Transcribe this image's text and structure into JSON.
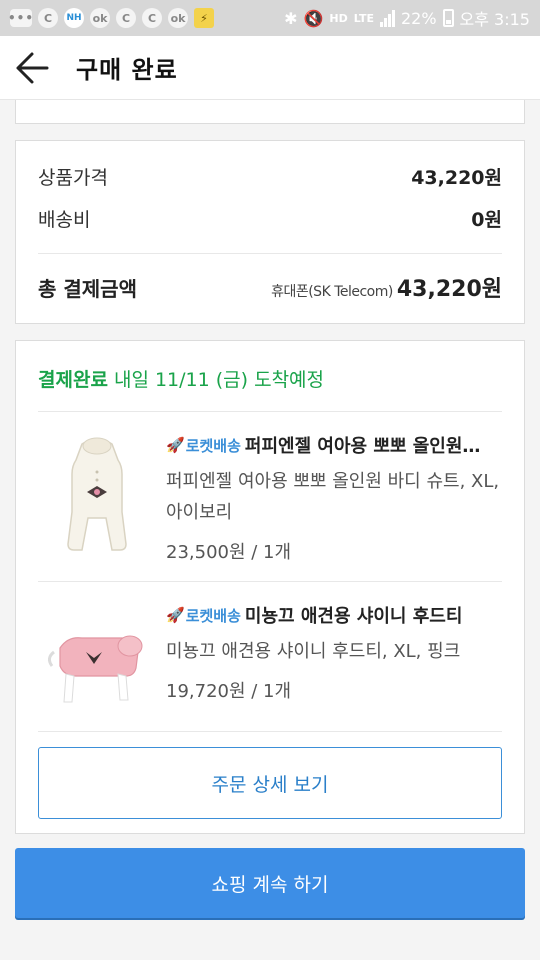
{
  "status_bar": {
    "icons": [
      "notification-dots-icon",
      "c-app-icon",
      "nh-app-icon",
      "ok-app-icon",
      "c-app-icon",
      "c-app-icon",
      "ok-app-icon",
      "pikachu-app-icon"
    ],
    "nh_text": "NH",
    "ok_text": "ok",
    "c_text": "C",
    "right_icons": [
      "bluetooth-icon",
      "mute-icon",
      "hd-voice-icon",
      "lte-icon",
      "signal-icon",
      "battery-icon"
    ],
    "hd_text": "HD",
    "lte_text": "LTE",
    "battery": "22%",
    "time": "오후 3:15"
  },
  "header": {
    "title": "구매 완료"
  },
  "price_summary": {
    "product_price_label": "상품가격",
    "product_price_value": "43,220원",
    "shipping_label": "배송비",
    "shipping_value": "0원",
    "total_label": "총 결제금액",
    "payment_method": "휴대폰(SK Telecom)",
    "total_value": "43,220원"
  },
  "order": {
    "status_bold": "결제완료",
    "status_rest": " 내일 11/11 (금) 도착예정",
    "items": [
      {
        "badge": "로켓배송",
        "name": "퍼피엔젤 여아용 뽀뽀 올인원…",
        "option": "퍼피엔젤 여아용 뽀뽀 올인원 바디 슈트, XL, 아이보리",
        "price": "23,500원 / 1개"
      },
      {
        "badge": "로켓배송",
        "name": "미뇽끄 애견용 샤이니 후드티",
        "option": "미뇽끄 애견용 샤이니 후드티, XL, 핑크",
        "price": "19,720원 / 1개"
      }
    ],
    "detail_button": "주문 상세 보기"
  },
  "continue_button": "쇼핑 계속 하기",
  "colors": {
    "status_green": "#1aa34a",
    "accent_blue": "#3d8ee6",
    "rocket_blue": "#3b8fd8"
  }
}
